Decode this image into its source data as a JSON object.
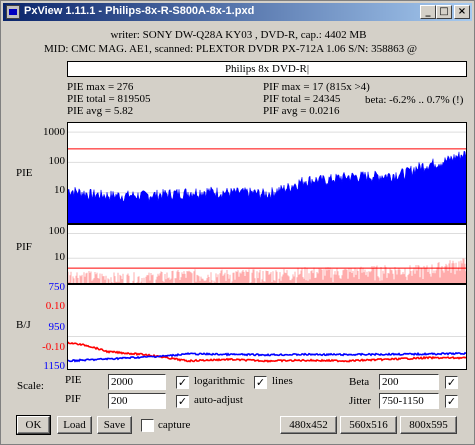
{
  "window": {
    "title": "PxView 1.11.1  -  Philips-8x-R-S800A-8x-1.pxd",
    "minimize": "_",
    "maximize": "□",
    "close": "×"
  },
  "info": {
    "writer_line": "writer: SONY DW-Q28A KY03 , DVD-R, cap.: 4402 MB",
    "mid_line": "MID: CMC MAG. AE1, scanned: PLEXTOR DVDR PX-712A 1.06 S/N: 358863 @",
    "disc_name": "Philips 8x DVD-R|"
  },
  "stats": {
    "pie_max": "PIE max = 276",
    "pie_total": "PIE total = 819505",
    "pie_avg": "PIE avg = 5.82",
    "pif_max": "PIF max = 17 (815x >4)",
    "pif_total": "PIF total = 24345",
    "pif_avg": "PIF avg = 0.0216",
    "beta": "beta: -6.2% .. 0.7% (!)"
  },
  "chart_data": [
    {
      "type": "area",
      "name": "PIE",
      "ylabel": "PIE",
      "scale": "log",
      "ylim": [
        1,
        2000
      ],
      "yticks": [
        "1000",
        "100",
        "10"
      ],
      "threshold": 280,
      "x": [
        0,
        5,
        10,
        15,
        20,
        25,
        30,
        35,
        40,
        45,
        50,
        55,
        60,
        65,
        70,
        75,
        80,
        85,
        90,
        95,
        100
      ],
      "values": [
        12,
        9,
        8,
        8,
        8,
        9,
        10,
        11,
        10,
        10,
        9,
        14,
        26,
        26,
        33,
        35,
        36,
        45,
        82,
        110,
        190
      ],
      "color": "#0000ff"
    },
    {
      "type": "area",
      "name": "PIF",
      "ylabel": "PIF",
      "scale": "log",
      "ylim": [
        1,
        200
      ],
      "yticks": [
        "100",
        "10"
      ],
      "threshold": 4,
      "x": [
        0,
        10,
        20,
        30,
        40,
        50,
        60,
        70,
        80,
        90,
        100
      ],
      "values": [
        2,
        1.5,
        1.5,
        2,
        2,
        2,
        2.5,
        2.5,
        3,
        3,
        6
      ],
      "color": "#ff6a6a"
    },
    {
      "type": "line",
      "name": "B/J",
      "ylabel": "B/J",
      "yticks_left": [
        "750",
        "0.10",
        "950",
        "-0.10",
        "1150"
      ],
      "series": [
        {
          "name": "Beta",
          "x": [
            0,
            5,
            10,
            20,
            25,
            30,
            40,
            50,
            60,
            70,
            80,
            90,
            100
          ],
          "values": [
            -0.02,
            -0.03,
            -0.05,
            -0.06,
            -0.07,
            -0.08,
            -0.075,
            -0.08,
            -0.078,
            -0.08,
            -0.075,
            -0.07,
            -0.07
          ],
          "color": "#ff0000"
        },
        {
          "name": "Jitter",
          "x": [
            0,
            5,
            10,
            20,
            25,
            30,
            40,
            50,
            60,
            70,
            80,
            90,
            100
          ],
          "values": [
            1120,
            1115,
            1110,
            1100,
            1095,
            1085,
            1088,
            1090,
            1088,
            1089,
            1087,
            1086,
            1083
          ],
          "color": "#0000ff"
        }
      ],
      "beta_range": [
        0.1,
        -0.1
      ],
      "jitter_range": [
        750,
        1150
      ]
    }
  ],
  "scale": {
    "label": "Scale:",
    "pie_label": "PIE",
    "pie_value": "2000",
    "pif_label": "PIF",
    "pif_value": "200",
    "logarithmic_label": "logarithmic",
    "lines_label": "lines",
    "auto_adjust_label": "auto-adjust",
    "beta_label": "Beta",
    "beta_value": "200",
    "jitter_label": "Jitter",
    "jitter_value": "750-1150",
    "checked_mark": "✓",
    "logarithmic_checked": true,
    "lines_checked": true,
    "auto_adjust_checked": true,
    "capture_checked": false
  },
  "buttons": {
    "ok": "OK",
    "load": "Load",
    "save": "Save",
    "capture_label": "capture",
    "size1": "480x452",
    "size2": "560x516",
    "size3": "800x595"
  }
}
